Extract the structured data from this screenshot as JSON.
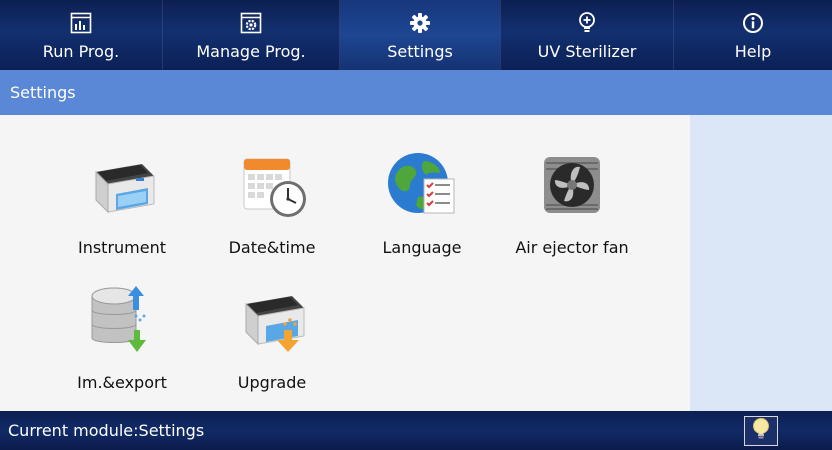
{
  "tabs": [
    {
      "label": "Run Prog.",
      "icon": "chart-icon"
    },
    {
      "label": "Manage Prog.",
      "icon": "gear-box-icon"
    },
    {
      "label": "Settings",
      "icon": "gear-icon",
      "active": true
    },
    {
      "label": "UV Sterilizer",
      "icon": "uv-bulb-icon"
    },
    {
      "label": "Help",
      "icon": "info-icon"
    }
  ],
  "title": "Settings",
  "items": [
    {
      "label": "Instrument",
      "icon": "instrument-icon"
    },
    {
      "label": "Date&time",
      "icon": "calendar-clock-icon"
    },
    {
      "label": "Language",
      "icon": "globe-checklist-icon"
    },
    {
      "label": "Air ejector fan",
      "icon": "fan-icon"
    },
    {
      "label": "Im.&export",
      "icon": "database-icon"
    },
    {
      "label": "Upgrade",
      "icon": "upgrade-icon"
    }
  ],
  "status": {
    "text": "Current module:Settings",
    "light_icon": "light-bulb-icon"
  },
  "colors": {
    "top_bar": "#0d1f52",
    "title_bar": "#5b88d6",
    "content_bg": "#f5f5f5",
    "side_panel": "#dbe6f7"
  }
}
